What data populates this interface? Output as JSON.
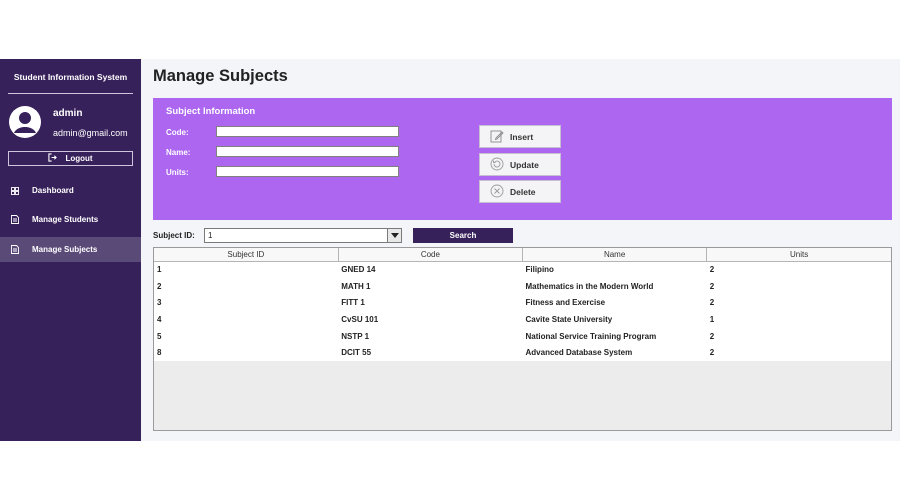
{
  "sidebar": {
    "system_title": "Student Information System",
    "user": {
      "name": "admin",
      "email": "admin@gmail.com"
    },
    "logout_label": "Logout",
    "items": [
      {
        "label": "Dashboard",
        "icon": "dashboard-grid-icon"
      },
      {
        "label": "Manage Students",
        "icon": "document-icon"
      },
      {
        "label": "Manage Subjects",
        "icon": "document-icon",
        "active": true
      }
    ]
  },
  "main": {
    "page_title": "Manage Subjects",
    "subject_info": {
      "title": "Subject Information",
      "fields": [
        {
          "label": "Code:",
          "value": ""
        },
        {
          "label": "Name:",
          "value": ""
        },
        {
          "label": "Units:",
          "value": ""
        }
      ],
      "buttons": [
        {
          "label": "Insert",
          "icon": "edit-icon"
        },
        {
          "label": "Update",
          "icon": "refresh-icon"
        },
        {
          "label": "Delete",
          "icon": "delete-icon"
        }
      ]
    },
    "search": {
      "label": "Subject ID:",
      "selected": "1",
      "button_label": "Search"
    },
    "table": {
      "columns": [
        "Subject ID",
        "Code",
        "Name",
        "Units"
      ],
      "rows": [
        [
          "1",
          "GNED 14",
          "Filipino",
          "2"
        ],
        [
          "2",
          "MATH 1",
          "Mathematics in the Modern World",
          "2"
        ],
        [
          "3",
          "FITT 1",
          "Fitness and Exercise",
          "2"
        ],
        [
          "4",
          "CvSU 101",
          "Cavite State University",
          "1"
        ],
        [
          "5",
          "NSTP 1",
          "National Service Training Program",
          "2"
        ],
        [
          "8",
          "DCIT 55",
          "Advanced Database System",
          "2"
        ]
      ]
    }
  },
  "colors": {
    "sidebar": "#37215a",
    "sidebar_active": "#5a4a78",
    "panel": "#ac66f0",
    "search_button": "#37215a"
  }
}
